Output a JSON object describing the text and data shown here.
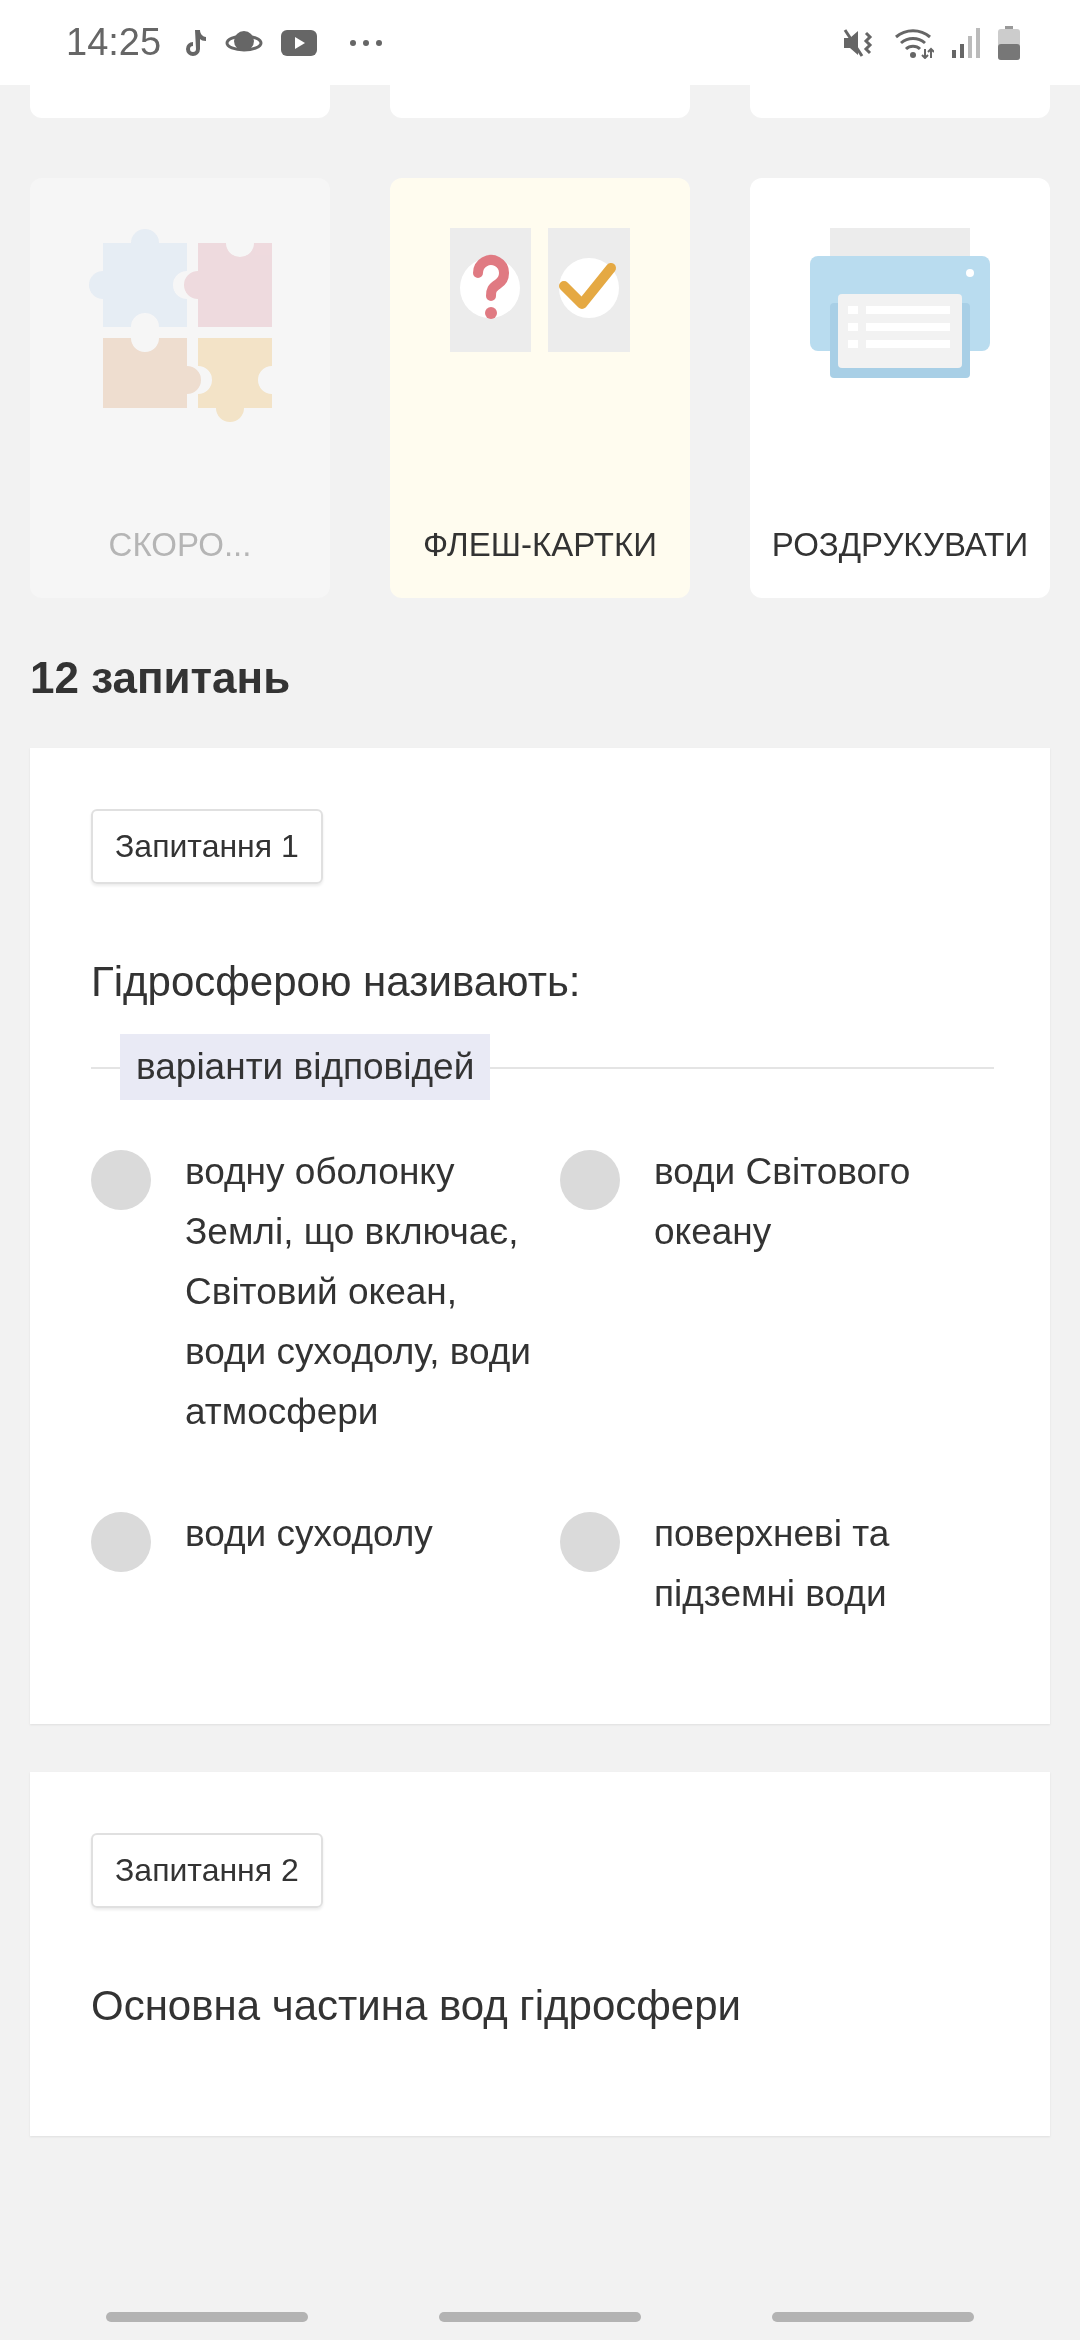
{
  "status_bar": {
    "time": "14:25"
  },
  "tiles": [
    {
      "label": "СКОРО...",
      "kind": "puzzle",
      "disabled": true
    },
    {
      "label": "ФЛЕШ-КАРТКИ",
      "kind": "flashcards",
      "disabled": false
    },
    {
      "label": "РОЗДРУКУВАТИ",
      "kind": "print",
      "disabled": false
    }
  ],
  "questions_heading": "12 запитань",
  "questions": [
    {
      "badge": "Запитання 1",
      "text": "Гідросферою називають:",
      "options_label": "варіанти відповідей",
      "options": [
        {
          "text": "водну оболонку Землі, що включає, Світовий океан, води суходолу, води атмосфери",
          "selected": false
        },
        {
          "text": "води Світового океану",
          "selected": false
        },
        {
          "text": "води суходолу",
          "selected": false
        },
        {
          "text": "поверхневі та підземні води",
          "selected": false
        }
      ]
    },
    {
      "badge": "Запитання 2",
      "text": "Основна частина вод гідросфери"
    }
  ]
}
